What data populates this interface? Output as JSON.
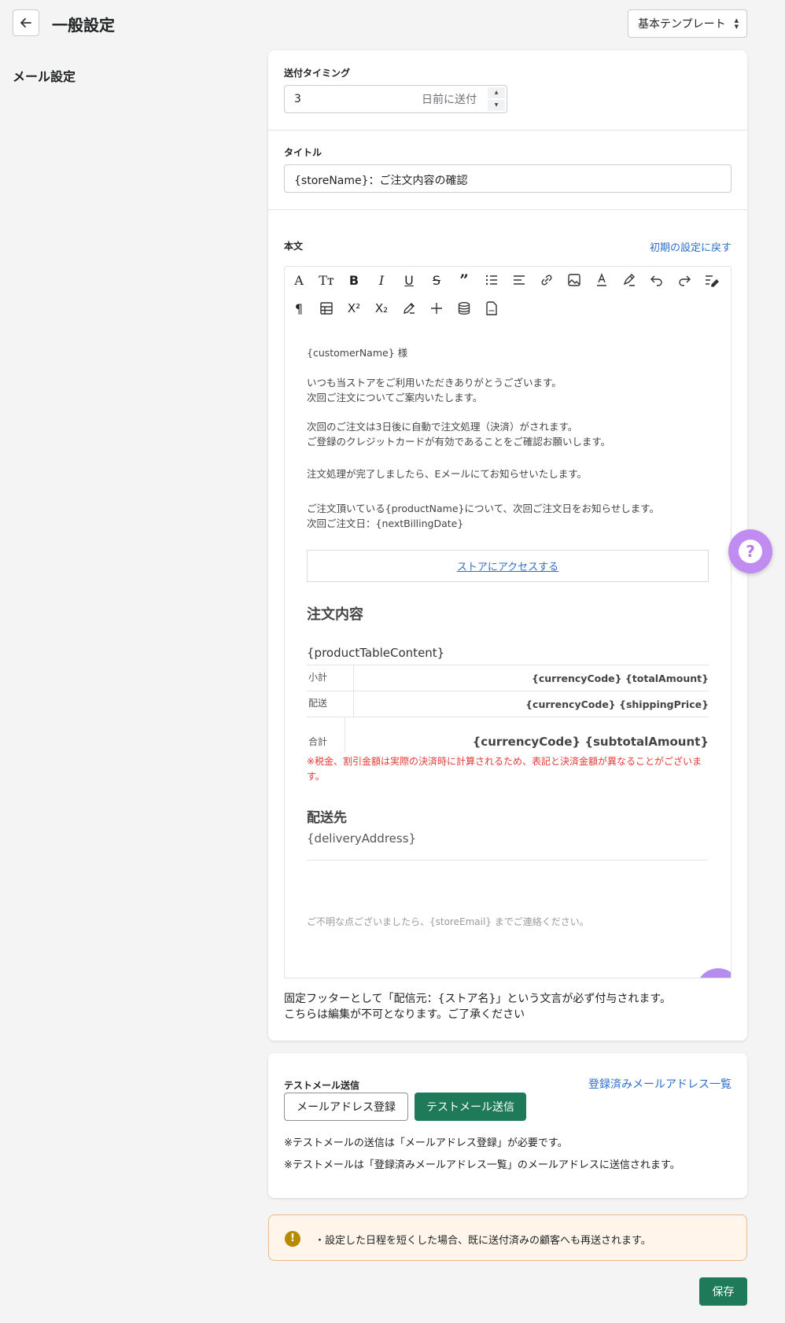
{
  "header": {
    "title": "一般設定",
    "template_select": "基本テンプレート"
  },
  "sidebar": {
    "title": "メール設定"
  },
  "timing": {
    "label": "送付タイミング",
    "value": "3",
    "suffix": "日前に送付"
  },
  "subject": {
    "label": "タイトル",
    "value": "{storeName}：ご注文内容の確認"
  },
  "body_section": {
    "label": "本文",
    "reset_link": "初期の設定に戻す"
  },
  "toolbar_icons": [
    "font-icon",
    "text-size-icon",
    "bold-icon",
    "italic-icon",
    "underline-icon",
    "strikethrough-icon",
    "quote-icon",
    "bullet-list-icon",
    "align-icon",
    "link-icon",
    "image-icon",
    "font-color-icon",
    "highlight-icon",
    "undo-icon",
    "redo-icon",
    "clear-format-icon",
    "paragraph-icon",
    "table-icon",
    "superscript-icon",
    "subscript-icon",
    "draw-icon",
    "horizontal-rule-icon",
    "database-icon",
    "html-file-icon"
  ],
  "email": {
    "greeting": "{customerName} 様",
    "p1": "いつも当ストアをご利用いただきありがとうございます。\n次回ご注文についてご案内いたします。",
    "p2": "次回のご注文は3日後に自動で注文処理（決済）がされます。\nご登録のクレジットカードが有効であることをご確認お願いします。",
    "p3": "注文処理が完了しましたら、Eメールにてお知らせいたします。",
    "p4": "ご注文頂いている{productName}について、次回ご注文日をお知らせします。\n次回ご注文日：{nextBillingDate}",
    "access_button": "ストアにアクセスする",
    "order_heading": "注文内容",
    "product_table": "{productTableContent}",
    "summary": [
      {
        "label": "小計",
        "value": "{currencyCode} {totalAmount}"
      },
      {
        "label": "配送",
        "value": "{currencyCode} {shippingPrice}"
      },
      {
        "label": "合計",
        "value": "{currencyCode} {subtotalAmount}"
      }
    ],
    "tax_note": "※税金、割引金額は実際の決済時に計算されるため、表記と決済金額が異なることがございます。",
    "delivery_heading": "配送先",
    "delivery_address": "{deliveryAddress}",
    "contact_note": "ご不明な点ございましたら、{storeEmail} までご連絡ください。"
  },
  "footer_note": {
    "line1": "固定フッターとして「配信元：{ストア名}」という文言が必ず付与されます。",
    "line2": "こちらは編集が不可となります。ご了承ください"
  },
  "test_mail": {
    "label": "テストメール送信",
    "registered_link": "登録済みメールアドレス一覧",
    "register_button": "メールアドレス登録",
    "send_button": "テストメール送信",
    "note1": "※テストメールの送信は「メールアドレス登録」が必要です。",
    "note2": "※テストメールは「登録済みメールアドレス一覧」のメールアドレスに送信されます。"
  },
  "warning": {
    "icon": "!",
    "text": "・設定した日程を短くした場合、既に送付済みの顧客へも再送されます。"
  },
  "save_button": "保存",
  "help_button": "?",
  "colors": {
    "accent_green": "#1f7a5a",
    "link_blue": "#2c6ecb",
    "warning_red": "#e53935",
    "help_purple": "#c08cf2"
  }
}
